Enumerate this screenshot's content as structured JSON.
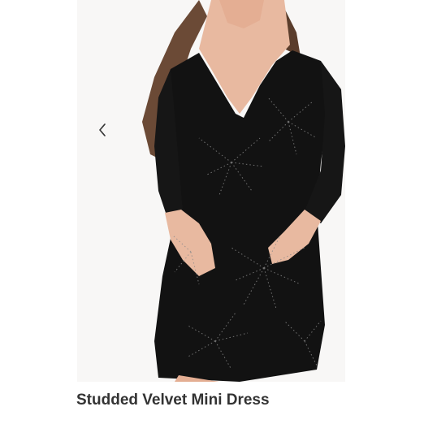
{
  "product": {
    "title": "Studded Velvet Mini Dress",
    "image_alt": "Model wearing black studded velvet long-sleeve mini dress"
  },
  "carousel": {
    "prev_icon": "chevron-left-icon"
  },
  "colors": {
    "background": "#ffffff",
    "dress": "#111111",
    "title_text": "#333333"
  }
}
